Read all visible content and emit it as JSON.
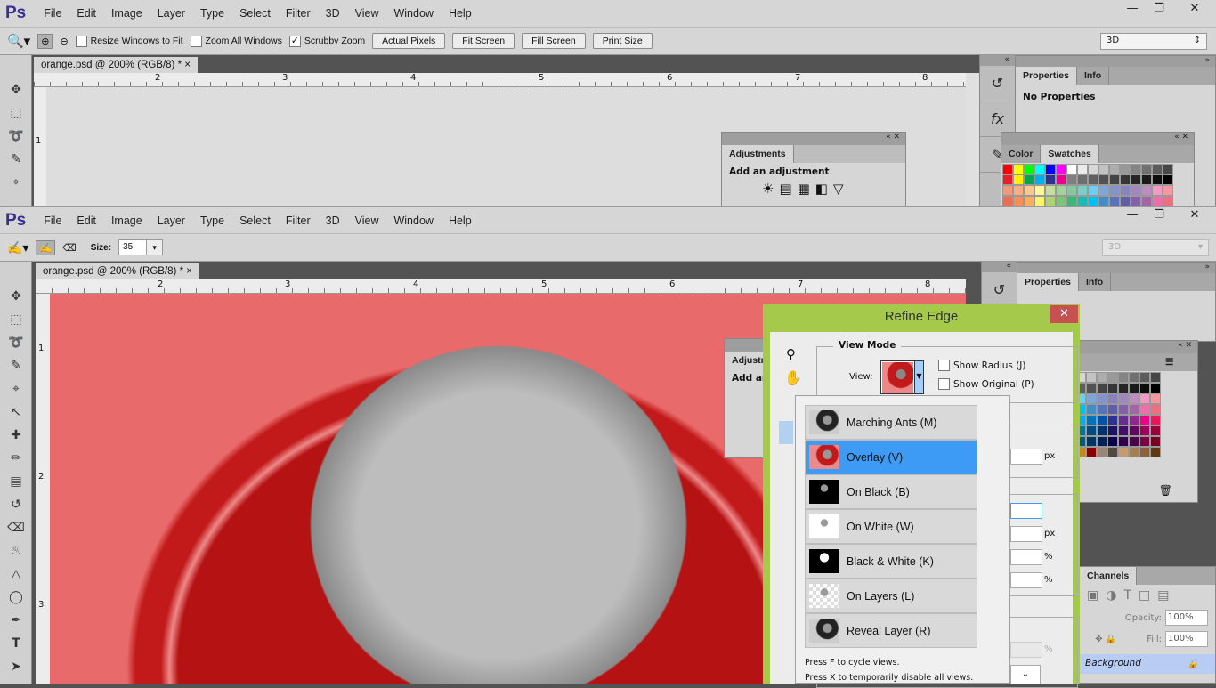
{
  "app": {
    "logo": "Ps",
    "menu": [
      "File",
      "Edit",
      "Image",
      "Layer",
      "Type",
      "Select",
      "Filter",
      "3D",
      "View",
      "Window",
      "Help"
    ],
    "window_controls": [
      "minimize",
      "restore",
      "close"
    ]
  },
  "top_window": {
    "options": {
      "resize_windows": "Resize Windows to Fit",
      "resize_checked": false,
      "zoom_all": "Zoom All Windows",
      "zoom_all_checked": false,
      "scrubby": "Scrubby Zoom",
      "scrubby_checked": true,
      "actual_pixels": "Actual Pixels",
      "fit_screen": "Fit Screen",
      "fill_screen": "Fill Screen",
      "print_size": "Print Size",
      "workspace": "3D"
    },
    "doc_tab": "orange.psd @ 200% (RGB/8) *",
    "ruler": [
      "2",
      "3",
      "4",
      "5",
      "6",
      "7",
      "8"
    ],
    "vruler": [
      "1"
    ],
    "properties": {
      "tabs": [
        "Properties",
        "Info"
      ],
      "content": "No Properties"
    },
    "adjustments": {
      "tab": "Adjustments",
      "heading": "Add an adjustment"
    },
    "color_panel": {
      "tabs": [
        "Color",
        "Swatches"
      ]
    }
  },
  "bottom_window": {
    "options": {
      "size_label": "Size:",
      "size_value": "35",
      "workspace": "3D"
    },
    "doc_tab": "orange.psd @ 200% (RGB/8) *",
    "ruler": [
      "2",
      "3",
      "4",
      "5",
      "6",
      "7",
      "8"
    ],
    "vruler": [
      "1",
      "2",
      "3"
    ],
    "properties": {
      "tabs": [
        "Properties",
        "Info"
      ]
    },
    "adjustments": {
      "tab": "Adjustments",
      "heading": "Add an adjustment"
    },
    "layers": {
      "tab": "Channels",
      "opacity_label": "Opacity:",
      "opacity": "100%",
      "fill_label": "Fill:",
      "fill": "100%",
      "layer": "Background"
    }
  },
  "refine_edge": {
    "title": "Refine Edge",
    "view_mode": "View Mode",
    "view_label": "View:",
    "show_radius": "Show Radius (J)",
    "show_original": "Show Original (P)",
    "px": "px",
    "pct": "%",
    "options": [
      {
        "label": "Marching Ants (M)",
        "thumb": "ants"
      },
      {
        "label": "Overlay (V)",
        "thumb": "overlay",
        "selected": true
      },
      {
        "label": "On Black (B)",
        "thumb": "black"
      },
      {
        "label": "On White (W)",
        "thumb": "white"
      },
      {
        "label": "Black & White (K)",
        "thumb": "bw"
      },
      {
        "label": "On Layers (L)",
        "thumb": "layers"
      },
      {
        "label": "Reveal Layer (R)",
        "thumb": "ants"
      }
    ],
    "hint1": "Press F to cycle views.",
    "hint2": "Press X to temporarily disable all views."
  },
  "colors": {
    "accent": "#3d9bf5",
    "dialog_frame": "#a4c94b",
    "close": "#c75050",
    "overlay_red": "#c41a1a"
  },
  "swatches": [
    [
      "#ff0000",
      "#ffff00",
      "#00ff00",
      "#00ffff",
      "#0000ff",
      "#ff00ff",
      "#ffffff",
      "#ebebeb",
      "#d6d6d6",
      "#c2c2c2",
      "#adadad",
      "#999999",
      "#858585",
      "#707070",
      "#5c5c5c",
      "#474747"
    ],
    [
      "#ed1c24",
      "#fff200",
      "#00a651",
      "#00aeef",
      "#2e3192",
      "#ec008c",
      "#7f7f7f",
      "#6e6e6e",
      "#606060",
      "#525252",
      "#444444",
      "#363636",
      "#262626",
      "#1a1a1a",
      "#0d0d0d",
      "#000000"
    ],
    [
      "#f7977a",
      "#f9ad81",
      "#fdc68a",
      "#fff79a",
      "#c4df9b",
      "#a2d39c",
      "#82ca9d",
      "#7bcdc8",
      "#6ecff6",
      "#7ea7d8",
      "#8493ca",
      "#8882be",
      "#a187be",
      "#bc8dbf",
      "#f49ac2",
      "#f6989d"
    ],
    [
      "#f26c4f",
      "#f68e55",
      "#fbaf5c",
      "#fff467",
      "#acd372",
      "#7cc576",
      "#3bb878",
      "#1abbb4",
      "#00bff3",
      "#438cca",
      "#5574b9",
      "#605ca8",
      "#855fa8",
      "#a763a8",
      "#f06ea9",
      "#f26d7d"
    ],
    [
      "#ed1c24",
      "#f26522",
      "#f7941d",
      "#fff200",
      "#8dc73f",
      "#39b54a",
      "#00a651",
      "#00a99d",
      "#00aeef",
      "#0072bc",
      "#0054a6",
      "#2e3192",
      "#662d91",
      "#92278f",
      "#ec008c",
      "#ed145b"
    ],
    [
      "#9e0b0f",
      "#a0410d",
      "#a36209",
      "#aba000",
      "#598527",
      "#1a7b30",
      "#007236",
      "#00746b",
      "#0076a3",
      "#004b80",
      "#003471",
      "#1b1464",
      "#440e62",
      "#630460",
      "#9e005d",
      "#9e0039"
    ],
    [
      "#790000",
      "#7b2e00",
      "#7d4900",
      "#827b00",
      "#406618",
      "#005e20",
      "#005826",
      "#005952",
      "#005b7f",
      "#003663",
      "#002157",
      "#0d004c",
      "#32004b",
      "#4b0049",
      "#7b0046",
      "#7a0026"
    ],
    [
      "#8c6239",
      "#754c24",
      "#603913",
      "#736357",
      "#366a91",
      "#5c5124",
      "#c7b299",
      "#d6a32f",
      "#d2801e",
      "#8a0000",
      "#998675",
      "#534741",
      "#c69c6d",
      "#a67c52",
      "#8c6239",
      "#603913"
    ]
  ]
}
